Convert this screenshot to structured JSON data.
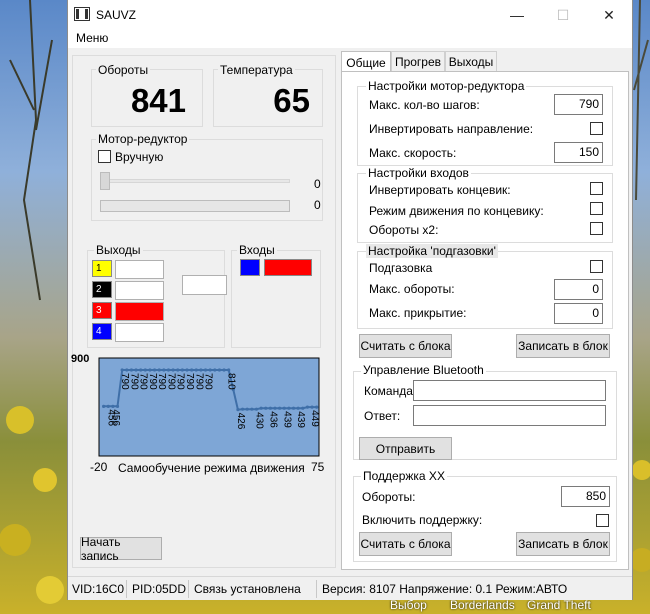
{
  "window": {
    "title": "SAUVZ",
    "minimize_glyph": "—",
    "maximize_glyph": "☐",
    "close_glyph": "✕"
  },
  "menu": {
    "items": [
      "Меню"
    ]
  },
  "rpm": {
    "label": "Обороты",
    "value": "841"
  },
  "temperature": {
    "label": "Температура",
    "value": "65"
  },
  "motor": {
    "group_label": "Мотор-редуктор",
    "manual_label": "Вручную",
    "manual_checked": false,
    "slider_value": "0",
    "progress_value": "0",
    "progress_fraction": 0
  },
  "outputs": {
    "group_label": "Выходы",
    "items": [
      {
        "num": "1",
        "color": "#ffff00",
        "num_color": "#000000",
        "state_color": "#ffffff"
      },
      {
        "num": "2",
        "color": "#000000",
        "num_color": "#ffffff",
        "state_color": "#ffffff"
      },
      {
        "num": "3",
        "color": "#ff0000",
        "num_color": "#ffffff",
        "state_color": "#ff0000"
      },
      {
        "num": "4",
        "color": "#0000ff",
        "num_color": "#ffffff",
        "state_color": "#ffffff"
      }
    ]
  },
  "inputs": {
    "group_label": "Входы",
    "color": "#0000ff",
    "state_color": "#ff0000"
  },
  "chart_data": {
    "type": "line",
    "title": "Самообучение режима движения",
    "x": [
      -18,
      -16,
      -14,
      -12,
      -10,
      -8,
      -6,
      -4,
      -2,
      0,
      2,
      4,
      6,
      8,
      10,
      12,
      14,
      16,
      18,
      20,
      22,
      24,
      26,
      28,
      30,
      32,
      34,
      36,
      38,
      40,
      42,
      44,
      46,
      48,
      50,
      52,
      54,
      56,
      58,
      60,
      62,
      64,
      66,
      68,
      70,
      72,
      74
    ],
    "values": [
      456,
      456,
      456,
      456,
      790,
      790,
      790,
      790,
      790,
      790,
      790,
      790,
      790,
      790,
      790,
      790,
      790,
      790,
      790,
      790,
      790,
      790,
      790,
      790,
      790,
      790,
      790,
      790,
      610,
      426,
      430,
      430,
      430,
      430,
      439,
      439,
      439,
      439,
      439,
      439,
      439,
      439,
      439,
      439,
      449,
      449,
      449
    ],
    "point_labels": [
      {
        "x": -16,
        "text": "456"
      },
      {
        "x": -14,
        "text": "456"
      },
      {
        "x": -10,
        "text": "790"
      },
      {
        "x": -6,
        "text": "790"
      },
      {
        "x": -2,
        "text": "790"
      },
      {
        "x": 2,
        "text": "790"
      },
      {
        "x": 6,
        "text": "790"
      },
      {
        "x": 10,
        "text": "790"
      },
      {
        "x": 14,
        "text": "790"
      },
      {
        "x": 18,
        "text": "790"
      },
      {
        "x": 22,
        "text": "790"
      },
      {
        "x": 26,
        "text": "790"
      },
      {
        "x": 36,
        "text": "810"
      },
      {
        "x": 40,
        "text": "426"
      },
      {
        "x": 48,
        "text": "430"
      },
      {
        "x": 54,
        "text": "436"
      },
      {
        "x": 60,
        "text": "439"
      },
      {
        "x": 66,
        "text": "439"
      },
      {
        "x": 72,
        "text": "449"
      }
    ],
    "xlim": [
      -20,
      75
    ],
    "ylim": [
      0,
      900
    ],
    "ytick_label": "900",
    "xtick_labels": [
      "-20",
      "75"
    ],
    "background": "#7ea6d6",
    "line_color": "#3f6fa8"
  },
  "start_record_label": "Начать запись",
  "status": {
    "vid": "VID:16C0",
    "pid": "PID:05DD",
    "connection": "Связь установлена",
    "version": "Версия: 8107 Напряжение: 0.1 Режим:АВТО"
  },
  "tabs": {
    "items": [
      "Общие",
      "Прогрев",
      "Выходы"
    ],
    "active": 0
  },
  "motor_settings": {
    "title": "Настройки мотор-редуктора",
    "max_steps_label": "Макс. кол-во шагов:",
    "max_steps": "790",
    "invert_label": "Инвертировать направление:",
    "invert_checked": false,
    "max_speed_label": "Макс. скорость:",
    "max_speed": "150"
  },
  "input_settings": {
    "title": "Настройки  входов",
    "invert_limit_label": "Инвертировать концевик:",
    "limit_mode_label": "Режим движения по концевику:",
    "rpm_x2_label": "Обороты x2:"
  },
  "gas_settings": {
    "title": "Настройка 'подгазовки'",
    "enabled_label": "Подгазовка",
    "max_rpm_label": "Макс. обороты:",
    "max_rpm": "0",
    "max_close_label": "Макс. прикрытие:",
    "max_close": "0"
  },
  "block_buttons": {
    "read": "Считать с блока",
    "write": "Записать в блок"
  },
  "bluetooth": {
    "title": "Управление Bluetooth",
    "command_label": "Команда:",
    "command_value": "",
    "answer_label": "Ответ:",
    "answer_value": "",
    "send": "Отправить"
  },
  "idle": {
    "title": "Поддержка ХХ",
    "rpm_label": "Обороты:",
    "rpm": "850",
    "enable_label": "Включить поддержку:",
    "enable_checked": false
  },
  "taskbar": {
    "items": [
      "Выбор",
      "Borderlands",
      "Grand Theft"
    ]
  }
}
